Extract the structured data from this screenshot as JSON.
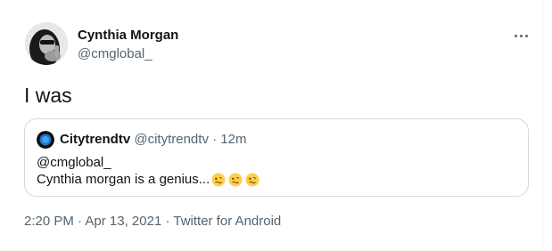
{
  "author": {
    "display_name": "Cynthia Morgan",
    "handle": "@cmglobal_"
  },
  "more_icon": "more-horizontal-icon",
  "tweet": {
    "text": "I was"
  },
  "quote": {
    "author_name": "Citytrendtv",
    "author_handle": "@citytrendtv",
    "separator": "·",
    "time": "12m",
    "mention": "@cmglobal_",
    "body": "Cynthia morgan is a genius...",
    "emojis": [
      "woozy-face-icon",
      "woozy-face-icon",
      "woozy-face-icon"
    ]
  },
  "meta": {
    "time": "2:20 PM",
    "sep1": "·",
    "date": "Apr 13, 2021",
    "sep2": "·",
    "source": "Twitter for Android"
  },
  "colors": {
    "text_primary": "#0f1419",
    "text_secondary": "#536471",
    "border": "#cfd9de",
    "emoji_yellow": "#ffcc4d"
  }
}
